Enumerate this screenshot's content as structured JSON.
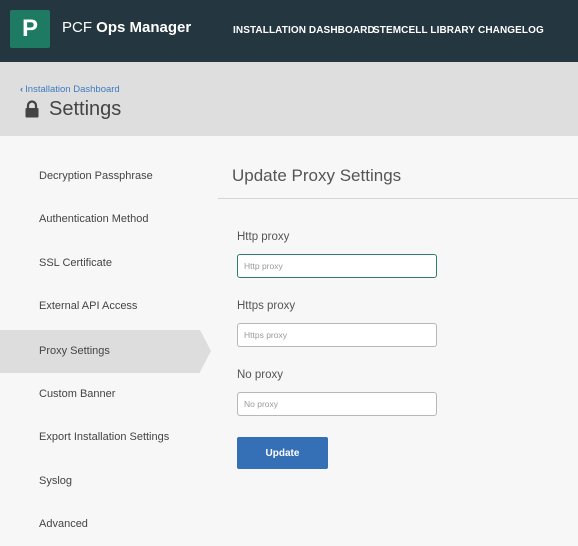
{
  "header": {
    "logo_letter": "P",
    "app_title_prefix": "PCF",
    "app_title_name": "Ops Manager",
    "nav": [
      "INSTALLATION DASHBOARD",
      "STEMCELL LIBRARY",
      "CHANGELOG"
    ]
  },
  "titlebar": {
    "breadcrumb": "Installation Dashboard",
    "breadcrumb_icon": "chevron-left-icon",
    "title_icon": "lock-icon",
    "title": "Settings"
  },
  "sidebar": {
    "active_index": 4,
    "items": [
      "Decryption Passphrase",
      "Authentication Method",
      "SSL Certificate",
      "External API Access",
      "Proxy Settings",
      "Custom Banner",
      "Export Installation Settings",
      "Syslog",
      "Advanced"
    ]
  },
  "main": {
    "title": "Update Proxy Settings",
    "fields": [
      {
        "label": "Http proxy",
        "placeholder": "Http proxy",
        "value": ""
      },
      {
        "label": "Https proxy",
        "placeholder": "Https proxy",
        "value": ""
      },
      {
        "label": "No proxy",
        "placeholder": "No proxy",
        "value": ""
      }
    ],
    "submit_label": "Update"
  },
  "colors": {
    "header_bg": "#243640",
    "logo_bg": "#1f7a63",
    "link": "#3e7bbf",
    "button": "#356fb5",
    "focus_border": "#2e7a6e"
  }
}
